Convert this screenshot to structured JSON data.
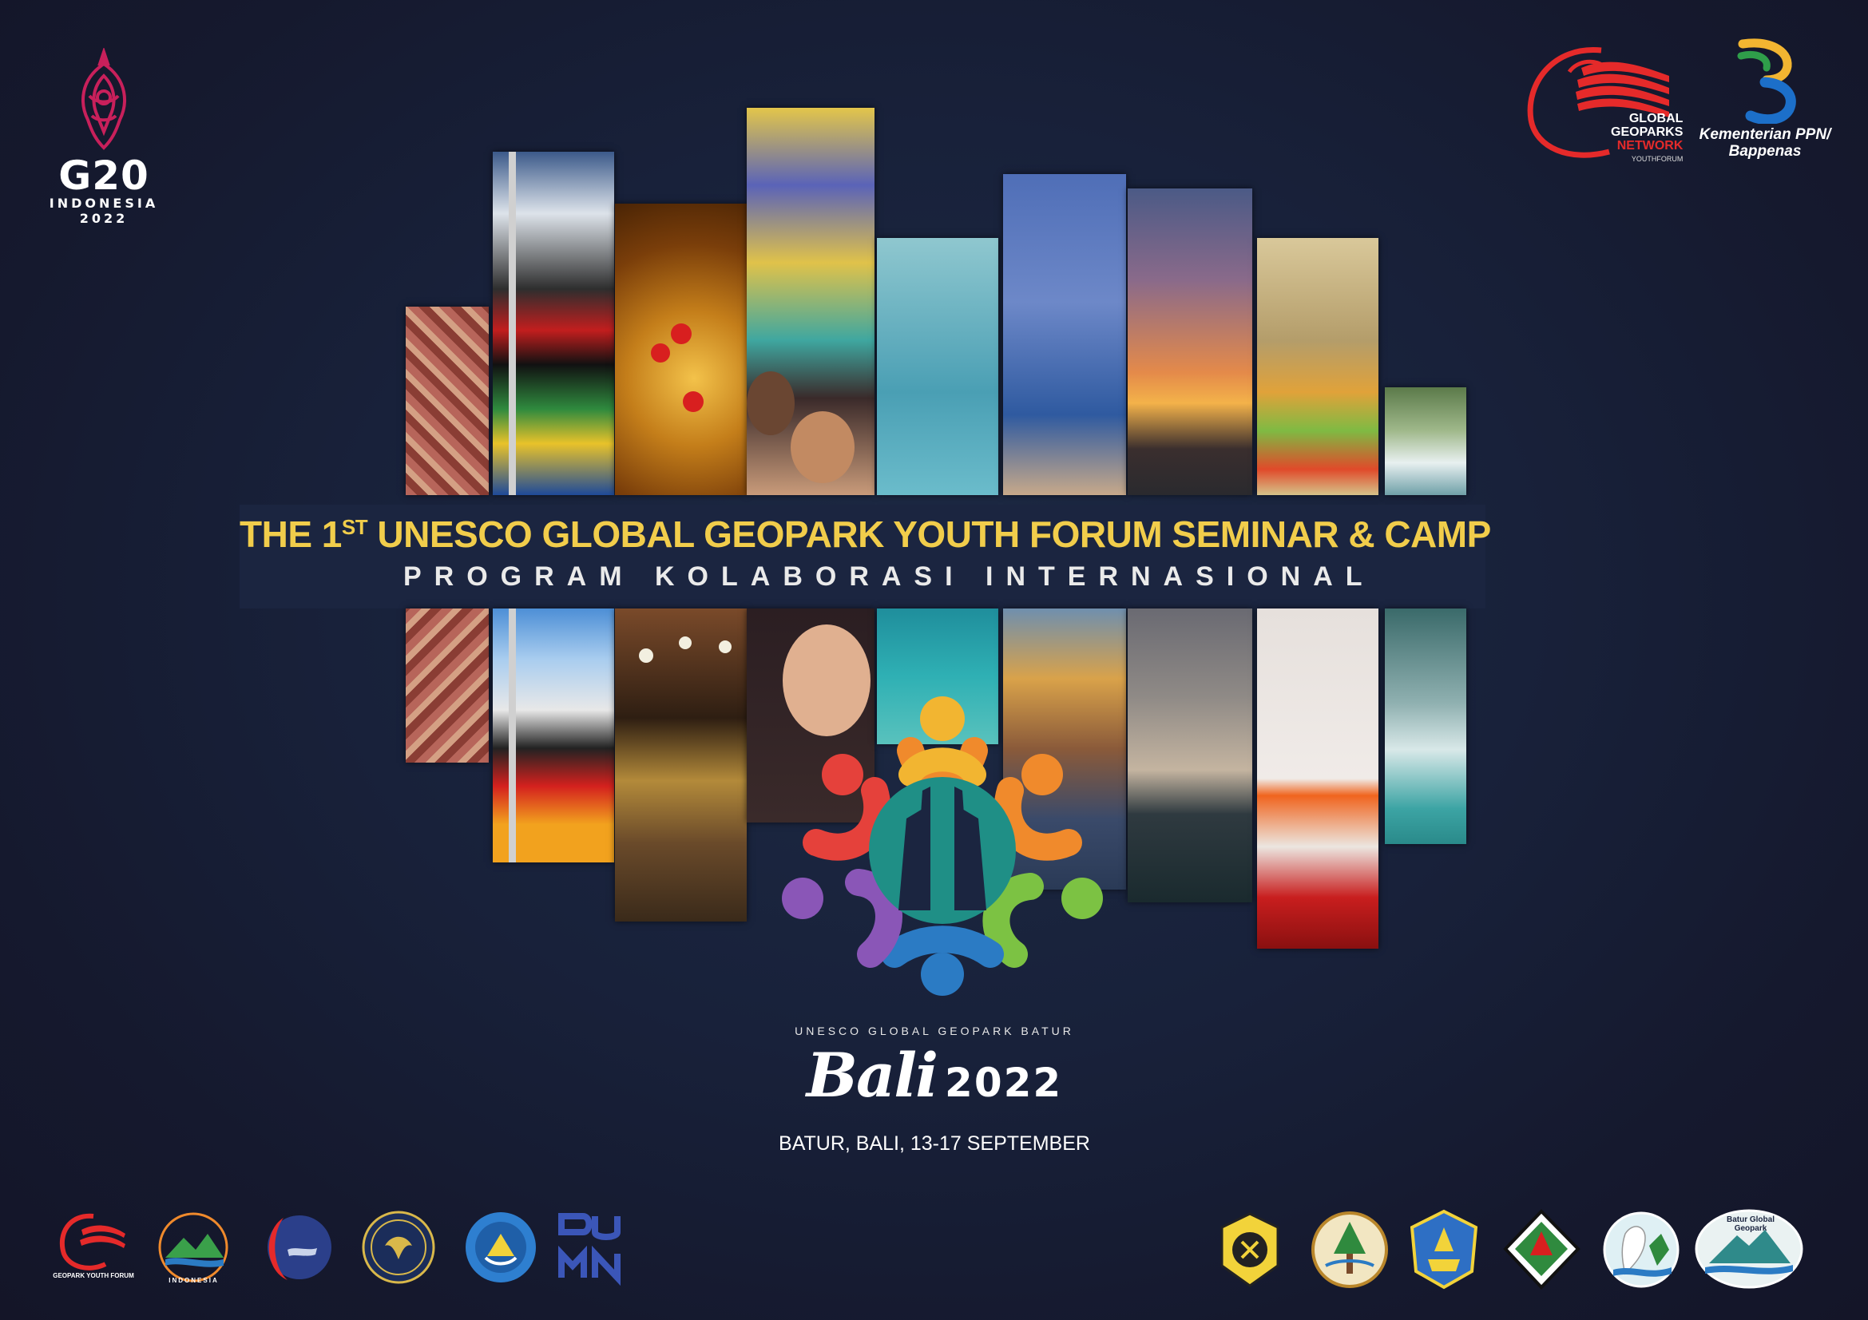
{
  "g20": {
    "title": "G20",
    "country": "INDONESIA",
    "year": "2022"
  },
  "partners_top": {
    "ggn_line1": "GLOBAL",
    "ggn_line2": "GEOPARKS",
    "ggn_line3": "NETWORK",
    "ggn_line4": "YOUTHFORUM",
    "bappenas_line1": "Kementerian PPN/",
    "bappenas_line2": "Bappenas"
  },
  "banner": {
    "title_prefix": "THE 1",
    "title_superscript": "ST",
    "title_rest": " UNESCO GLOBAL GEOPARK YOUTH FORUM SEMINAR & CAMP",
    "subtitle": "PROGRAM KOLABORASI INTERNASIONAL"
  },
  "event": {
    "organizer_line": "UNESCO GLOBAL GEOPARK BATUR",
    "place_word": "Bali",
    "year": "2022",
    "dates": "BATUR, BALI, 13-17 SEPTEMBER"
  },
  "logos_bottom": {
    "youth_forum_label": "GEOPARK YOUTH FORUM",
    "nasional_label": "INDONESIA",
    "batur_label": "Batur Global Geopark"
  },
  "colors": {
    "banner_yellow": "#f1cd4b",
    "background": "#18213a",
    "petal_red": "#e5413b",
    "petal_orange": "#f08a2c",
    "petal_yellow": "#f2b531",
    "petal_green": "#7cc243",
    "petal_blue": "#2b7bc4",
    "petal_purple": "#8a56b7",
    "center_teal": "#1f8f86"
  }
}
